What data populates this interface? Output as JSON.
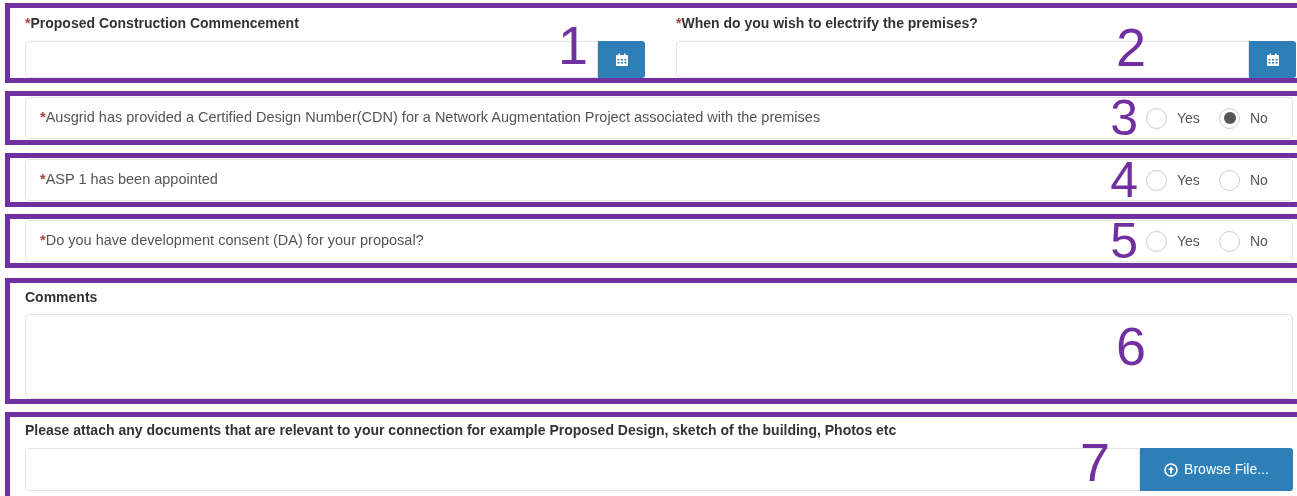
{
  "date_fields": [
    {
      "required_mark": "*",
      "label": "Proposed Construction Commencement",
      "marker": "1"
    },
    {
      "required_mark": "*",
      "label": "When do you wish to electrify the premises?",
      "marker": "2"
    }
  ],
  "questions": [
    {
      "required_mark": "*",
      "label": "Ausgrid has provided a Certified Design Number(CDN) for a Network Augmentation Project associated with the premises",
      "marker": "3",
      "options": [
        {
          "label": "Yes",
          "selected": false
        },
        {
          "label": "No",
          "selected": true
        }
      ]
    },
    {
      "required_mark": "*",
      "label": "ASP 1 has been appointed",
      "marker": "4",
      "options": [
        {
          "label": "Yes",
          "selected": false
        },
        {
          "label": "No",
          "selected": false
        }
      ]
    },
    {
      "required_mark": "*",
      "label": "Do you have development consent (DA) for your proposal?",
      "marker": "5",
      "options": [
        {
          "label": "Yes",
          "selected": false
        },
        {
          "label": "No",
          "selected": false
        }
      ]
    }
  ],
  "comments": {
    "label": "Comments",
    "marker": "6"
  },
  "attachment": {
    "label": "Please attach any documents that are relevant to your connection for example Proposed Design, sketch of the building, Photos etc",
    "button": "Browse File...",
    "marker": "7"
  }
}
